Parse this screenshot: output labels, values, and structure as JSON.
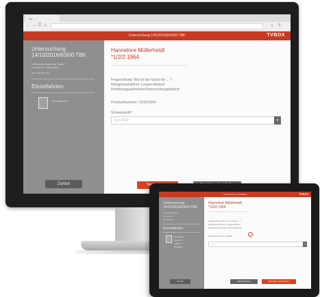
{
  "browser": {
    "tab_label": "Tür ...",
    "nav_back": "←",
    "nav_forward": "→",
    "nav_reload": "C",
    "nav_home": "⌂"
  },
  "header": {
    "title": "Untersuchung 14/10/2016/63/00 TBK",
    "logo": "TVBOX"
  },
  "sidebar": {
    "title": "Untersuchung 14/10/2016/63/00 TBK",
    "sub1": "Untersuchungen am Tagen",
    "sub2": "In weiteren Versuchen",
    "sub3": "Nr. 000 000 00",
    "section_title": "Einzelfahrten",
    "item_text": "Einzelfahrten",
    "button_label": "Zurück"
  },
  "main": {
    "title_line1": "Hannelore Müllerheidt",
    "title_line2": "*1/2/2 1964",
    "info_line1": "Fragestellung: Wie ist der Grund für ... ?",
    "info_line2": "Röntgenaufnahme: Lungen-Befund",
    "info_line3": "Hinführungsaufnahme/Untersuchungsbefund:",
    "protocol_line": "Protokollnummer: 12/2018/04",
    "select_label": "Schwerpunkt*",
    "select_value": "Lid: 2018",
    "select_arrow": "▾",
    "button_primary": "Tag bearbeiten",
    "button_secondary": "Aktivitäten abschließen"
  },
  "tablet": {
    "header_title": "Untersuchung 14/10/2016",
    "logo": "TVBOX",
    "sidebar_title": "Untersuchung 14/10/2016/63/00 TBK",
    "sidebar_sub1": "Untersuchungen",
    "sidebar_sub2": "In weiteren",
    "sidebar_sub3": "Nr. 000 000",
    "section_title": "Einzelfahrten",
    "item_text1": "Einzelfahrt",
    "item_text2": "Abfahrt 1",
    "item_text3": "Abfahrt 2",
    "item_text4": "Rückfahrt",
    "button_left": "Zurück",
    "title_line1": "Hannelore Müllerheidt",
    "title_line2": "*1/2/2 1964",
    "info_line1": "Fragestellung: Wie ist der Grund ... ?",
    "info_line2": "Röntgenaufnahme: Lungen-Befund",
    "info_line3": "Hinführungsaufnahme/Untersuchung",
    "protocol_line": "Protokollnummer: 12/2018",
    "select_value": "Lid",
    "select_arrow": "▾",
    "button_mid": "Tag bearbeiten",
    "button_right": "Aktivitäten abschließen"
  },
  "colors": {
    "accent": "#c73a22",
    "sidebar": "#8f8f8f"
  }
}
